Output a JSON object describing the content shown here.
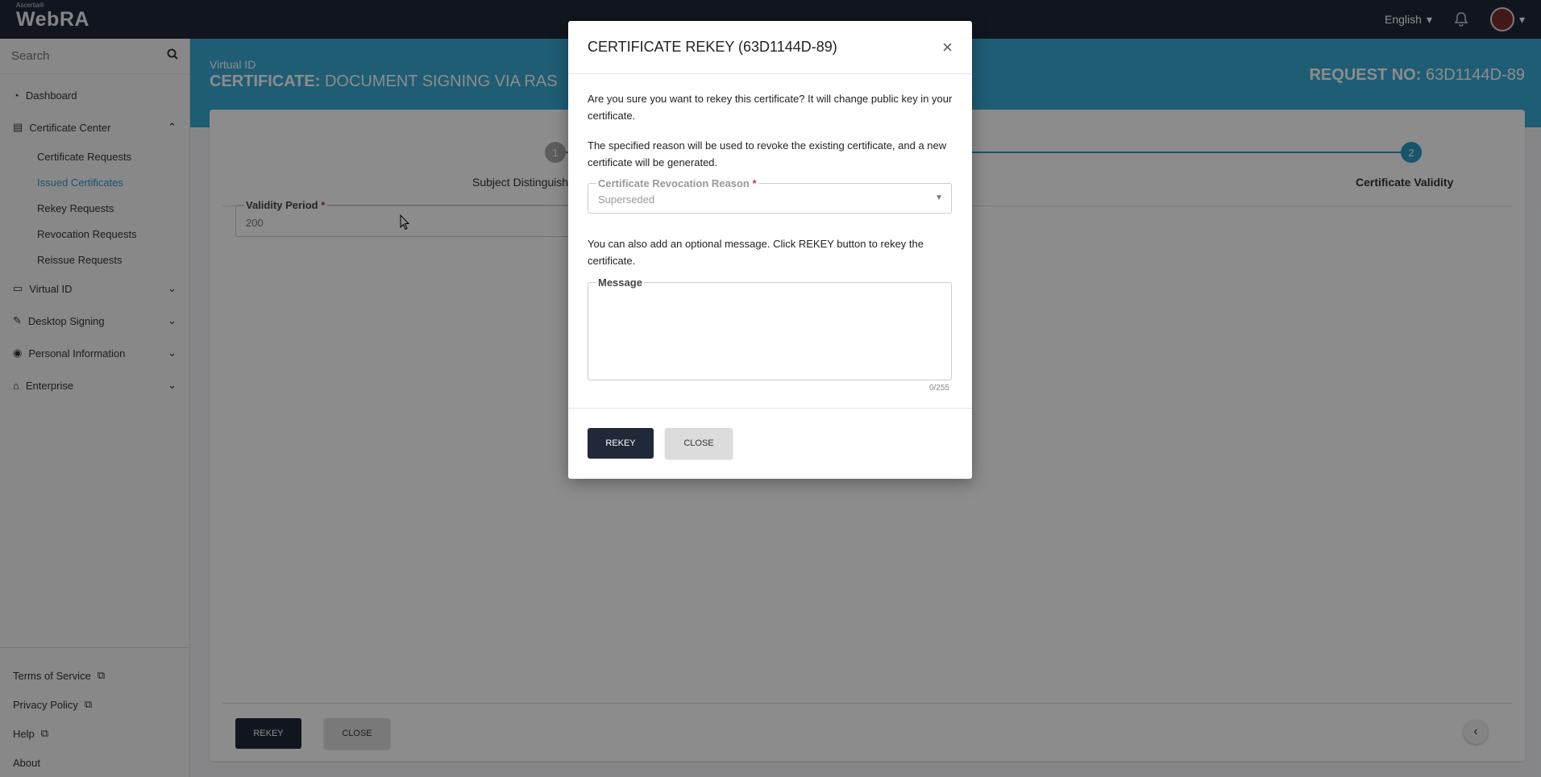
{
  "topbar": {
    "brand_small": "Ascertia®",
    "brand": "WebRA",
    "language": "English"
  },
  "sidebar": {
    "search_placeholder": "Search",
    "items": [
      {
        "label": "Dashboard",
        "icon": "dashboard-icon"
      },
      {
        "label": "Certificate Center",
        "icon": "certificate-icon"
      },
      {
        "label": "Virtual ID",
        "icon": "id-card-icon"
      },
      {
        "label": "Desktop Signing",
        "icon": "signing-icon"
      },
      {
        "label": "Personal Information",
        "icon": "user-icon"
      },
      {
        "label": "Enterprise",
        "icon": "bank-icon"
      }
    ],
    "sub_items": [
      {
        "label": "Certificate Requests"
      },
      {
        "label": "Issued Certificates"
      },
      {
        "label": "Rekey Requests"
      },
      {
        "label": "Revocation Requests"
      },
      {
        "label": "Reissue Requests"
      }
    ],
    "footer": [
      {
        "label": "Terms of Service"
      },
      {
        "label": "Privacy Policy"
      },
      {
        "label": "Help"
      },
      {
        "label": "About"
      }
    ]
  },
  "header": {
    "subtitle": "Virtual ID",
    "title_prefix": "CERTIFICATE:",
    "title": "DOCUMENT SIGNING VIA RAS",
    "request_prefix": "REQUEST NO:",
    "request_no": "63D1144D-89"
  },
  "stepper": {
    "step1_num": "1",
    "step1_label": "Subject Distinguished",
    "step2_num": "2",
    "step2_label": "Certificate Validity"
  },
  "form": {
    "validity_label": "Validity Period",
    "required_mark": "*",
    "validity_value": "200"
  },
  "card_footer": {
    "rekey": "REKEY",
    "close": "CLOSE"
  },
  "modal": {
    "title": "CERTIFICATE REKEY (63D1144D-89)",
    "close_glyph": "×",
    "p1": "Are you sure you want to rekey this certificate? It will change public key in your certificate.",
    "p2": "The specified reason will be used to revoke the existing certificate, and a new certificate will be generated.",
    "reason_label": "Certificate Revocation Reason",
    "reason_value": "Superseded",
    "p3": "You can also add an optional message. Click REKEY button to rekey the certificate.",
    "message_label": "Message",
    "message_value": "",
    "counter": "0/255",
    "rekey": "REKEY",
    "close": "CLOSE"
  }
}
